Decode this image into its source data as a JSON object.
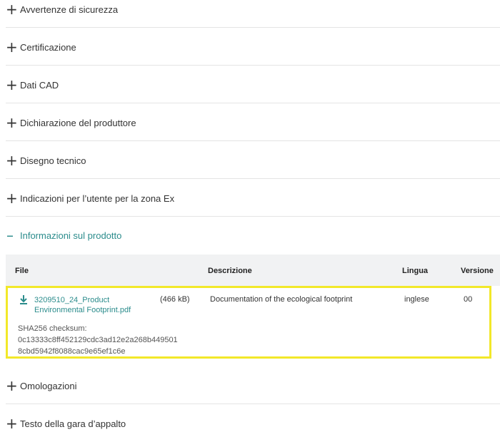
{
  "sections": [
    {
      "symbol": "+",
      "label": "Avvertenze di sicurezza"
    },
    {
      "symbol": "+",
      "label": "Certificazione"
    },
    {
      "symbol": "+",
      "label": "Dati CAD"
    },
    {
      "symbol": "+",
      "label": "Dichiarazione del produttore"
    },
    {
      "symbol": "+",
      "label": "Disegno tecnico"
    },
    {
      "symbol": "+",
      "label": "Indicazioni per l’utente per la zona Ex"
    },
    {
      "symbol": "–",
      "label": "Informazioni sul prodotto"
    },
    {
      "symbol": "+",
      "label": "Omologazioni"
    },
    {
      "symbol": "+",
      "label": "Testo della gara d’appalto"
    }
  ],
  "table": {
    "headers": {
      "file": "File",
      "description": "Descrizione",
      "language": "Lingua",
      "version": "Versione"
    },
    "row": {
      "file_line1": "3209510_24_Product",
      "file_line2": "Environmental Footprint.pdf",
      "size": "(466 kB)",
      "description": "Documentation of the ecological footprint",
      "language": "inglese",
      "version": "00",
      "checksum_label": "SHA256 checksum:",
      "checksum_line1": "0c13333c8ff452129cdc3ad12e2a268b449501",
      "checksum_line2": "8cbd5942f8088cac9e65ef1c6e"
    }
  },
  "colors": {
    "accent": "#2b8c8c",
    "highlight": "#f2e829",
    "header_bg": "#f1f2f3"
  }
}
